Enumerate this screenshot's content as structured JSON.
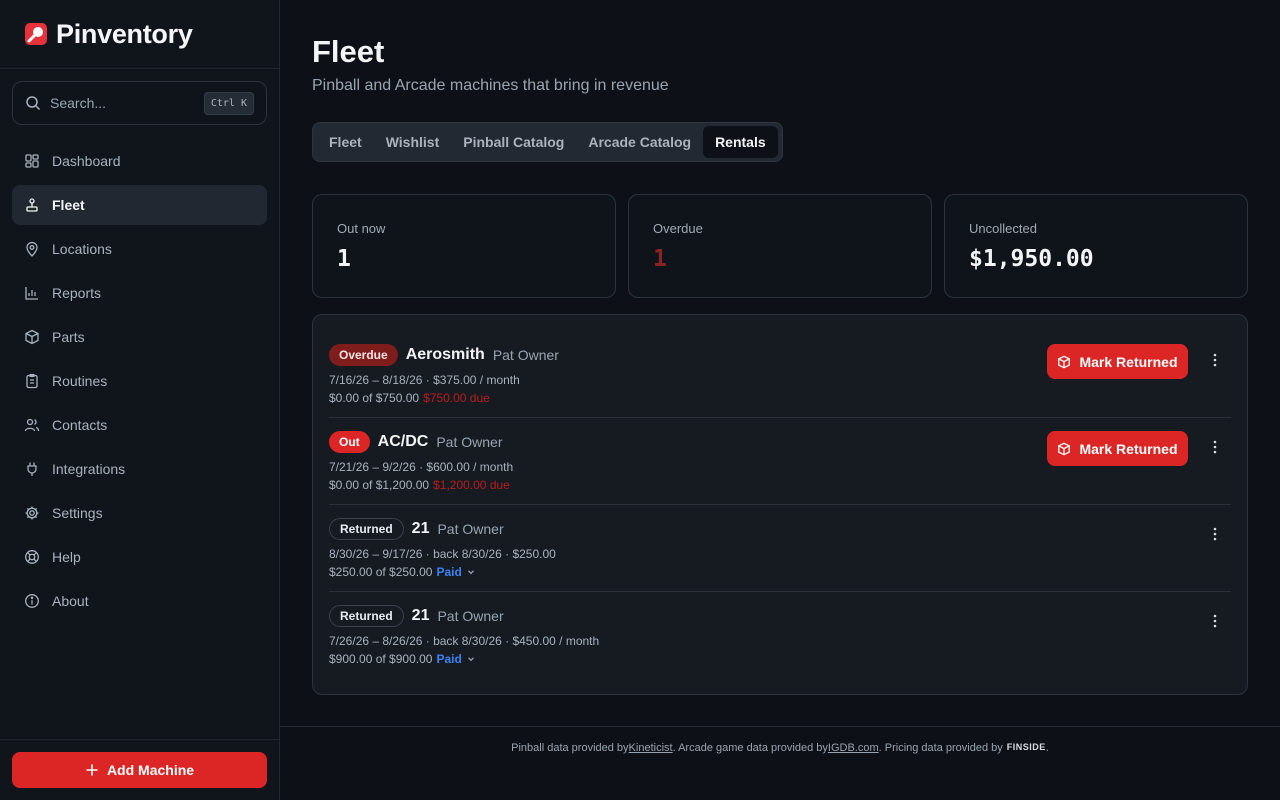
{
  "app": {
    "name": "Pinventory"
  },
  "search": {
    "placeholder": "Search...",
    "shortcut": "Ctrl K"
  },
  "nav": [
    {
      "label": "Dashboard",
      "icon": "dashboard-icon"
    },
    {
      "label": "Fleet",
      "icon": "joystick-icon",
      "active": true
    },
    {
      "label": "Locations",
      "icon": "map-pin-icon"
    },
    {
      "label": "Reports",
      "icon": "bar-chart-icon"
    },
    {
      "label": "Parts",
      "icon": "package-icon"
    },
    {
      "label": "Routines",
      "icon": "clipboard-list-icon"
    },
    {
      "label": "Contacts",
      "icon": "users-icon"
    },
    {
      "label": "Integrations",
      "icon": "plug-icon"
    },
    {
      "label": "Settings",
      "icon": "gear-icon"
    },
    {
      "label": "Help",
      "icon": "lifebuoy-icon"
    },
    {
      "label": "About",
      "icon": "info-icon"
    }
  ],
  "sidebar_footer": {
    "add_machine_label": "Add Machine"
  },
  "page": {
    "title": "Fleet",
    "subtitle": "Pinball and Arcade machines that bring in revenue"
  },
  "tabs": [
    {
      "label": "Fleet"
    },
    {
      "label": "Wishlist"
    },
    {
      "label": "Pinball Catalog"
    },
    {
      "label": "Arcade Catalog"
    },
    {
      "label": "Rentals",
      "active": true
    }
  ],
  "stats": {
    "out_now": {
      "label": "Out now",
      "value": "1"
    },
    "overdue": {
      "label": "Overdue",
      "value": "1"
    },
    "uncollected": {
      "label": "Uncollected",
      "value": "$1,950.00"
    }
  },
  "rentals": [
    {
      "status": "Overdue",
      "machine": "Aerosmith",
      "owner": "Pat Owner",
      "dates": "7/16/26 – 8/18/26 · $375.00 / month",
      "amount": "$0.00 of $750.00",
      "due": "$750.00 due",
      "action": "Mark Returned"
    },
    {
      "status": "Out",
      "machine": "AC/DC",
      "owner": "Pat Owner",
      "dates": "7/21/26 – 9/2/26 · $600.00 / month",
      "amount": "$0.00 of $1,200.00",
      "due": "$1,200.00 due",
      "action": "Mark Returned"
    },
    {
      "status": "Returned",
      "machine": "21",
      "owner": "Pat Owner",
      "dates": "8/30/26 – 9/17/26 · back 8/30/26 · $250.00",
      "amount": "$250.00 of $250.00",
      "paid": "Paid"
    },
    {
      "status": "Returned",
      "machine": "21",
      "owner": "Pat Owner",
      "dates": "7/26/26 – 8/26/26 · back 8/30/26 · $450.00 / month",
      "amount": "$900.00 of $900.00",
      "paid": "Paid"
    }
  ],
  "footer": {
    "text1": "Pinball data provided by ",
    "link1": "Kineticist",
    "text2": ". Arcade game data provided by ",
    "link2": "IGDB.com",
    "text3": ". Pricing data provided by ",
    "brand": "FINSIDE",
    "text4": "."
  },
  "colors": {
    "accent": "#dc2626",
    "overdue_badge": "#7f1d1d",
    "paid": "#3b82f6",
    "background": "#0d1117"
  }
}
